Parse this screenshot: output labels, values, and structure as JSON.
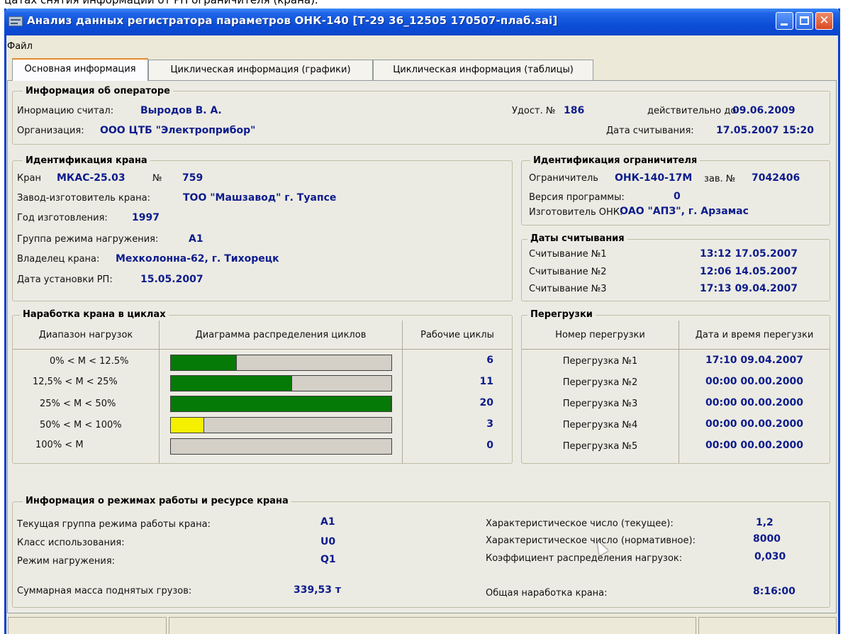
{
  "top_caption": "цатах снятия информации от РП ограничителя (крана).",
  "window": {
    "title": "Анализ данных регистратора параметров ОНК-140  [Т-29 36_12505 170507-плаб.sai]",
    "controls": {
      "minimize": "minimize-icon",
      "maximize": "maximize-icon",
      "close": "close-icon"
    }
  },
  "menu": {
    "file": "Файл"
  },
  "tabs": [
    {
      "label": "Основная информация",
      "active": true
    },
    {
      "label": "Циклическая информация (графики)",
      "active": false
    },
    {
      "label": "Циклическая информация (таблицы)",
      "active": false
    }
  ],
  "operator": {
    "title": "Информация об операторе",
    "read_by_label": "Инормацию считал:",
    "read_by": "Выродов В. А.",
    "cert_label": "Удост. №",
    "cert_no": "186",
    "valid_label": "действительно до",
    "valid_until": "09.06.2009",
    "org_label": "Организация:",
    "org": "ООО ЦТБ \"Электроприбор\"",
    "read_date_label": "Дата считывания:",
    "read_date": "17.05.2007 15:20"
  },
  "crane": {
    "title": "Идентификация крана",
    "crane_label": "Кран",
    "crane_model": "МКАС-25.03",
    "no_label": "№",
    "no": "759",
    "maker_label": "Завод-изготовитель крана:",
    "maker": "ТОО \"Машзавод\" г. Туапсе",
    "year_label": "Год изготовления:",
    "year": "1997",
    "group_label": "Группа режима нагружения:",
    "group": "А1",
    "owner_label": "Владелец крана:",
    "owner": "Мехколонна-62, г. Тихорецк",
    "install_label": "Дата установки РП:",
    "install_date": "15.05.2007"
  },
  "limiter": {
    "title": "Идентификация ограничителя",
    "limiter_label": "Ограничитель",
    "limiter": "ОНК-140-17М",
    "serial_label": "зав. №",
    "serial": "7042406",
    "version_label": "Версия программы:",
    "version": "0",
    "maker_label": "Изготовитель ОНК:",
    "maker": "ОАО \"АПЗ\", г. Арзамас"
  },
  "reads": {
    "title": "Даты считывания",
    "items": [
      {
        "label": "Считывание №1",
        "value": "13:12 17.05.2007"
      },
      {
        "label": "Считывание №2",
        "value": "12:06 14.05.2007"
      },
      {
        "label": "Считывание №3",
        "value": "17:13 09.04.2007"
      }
    ]
  },
  "cycles": {
    "title": "Наработка крана в циклах",
    "col_range": "Диапазон нагрузок",
    "col_chart": "Диаграмма распределения циклов",
    "col_cycles": "Рабочие циклы",
    "rows": [
      {
        "range": "0% < M < 12.5%",
        "cycles": "6",
        "fill": 0.3,
        "color": "#067a06"
      },
      {
        "range": "12,5% < M < 25%",
        "cycles": "11",
        "fill": 0.55,
        "color": "#067a06"
      },
      {
        "range": "25% < M < 50%",
        "cycles": "20",
        "fill": 1.0,
        "color": "#067a06"
      },
      {
        "range": "50% < M < 100%",
        "cycles": "3",
        "fill": 0.15,
        "color": "#f4f000"
      },
      {
        "range": "100% < M",
        "cycles": "0",
        "fill": 0.0,
        "color": "#067a06"
      }
    ]
  },
  "overloads": {
    "title": "Перегрузки",
    "col_no": "Номер перегрузки",
    "col_time": "Дата и время перегузки",
    "rows": [
      {
        "label": "Перегрузка №1",
        "value": "17:10 09.04.2007"
      },
      {
        "label": "Перегрузка №2",
        "value": "00:00 00.00.2000"
      },
      {
        "label": "Перегрузка №3",
        "value": "00:00 00.00.2000"
      },
      {
        "label": "Перегрузка №4",
        "value": "00:00 00.00.2000"
      },
      {
        "label": "Перегрузка №5",
        "value": "00:00 00.00.2000"
      }
    ]
  },
  "modes": {
    "title": "Информация о режимах работы и ресурсе крана",
    "current_group_label": "Текущая группа режима работы крана:",
    "current_group": "А1",
    "usage_class_label": "Класс использования:",
    "usage_class": "U0",
    "load_mode_label": "Режим нагружения:",
    "load_mode": "Q1",
    "total_mass_label": "Суммарная масса поднятых грузов:",
    "total_mass": "339,53 т",
    "char_current_label": "Характеристическое число (текущее):",
    "char_current": "1,2",
    "char_norm_label": "Характеристическое число (нормативное):",
    "char_norm": "8000",
    "load_dist_label": "Коэффициент распределения нагрузок:",
    "load_dist": "0,030",
    "total_time_label": "Общая наработка крана:",
    "total_time": "8:16:00"
  }
}
